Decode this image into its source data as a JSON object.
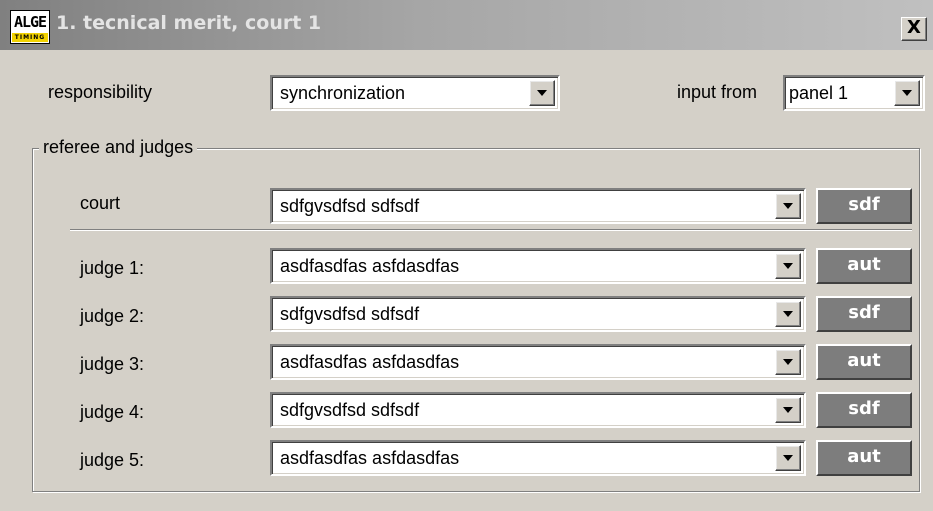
{
  "window": {
    "title": "1. tecnical merit, court 1",
    "logo_text": "ALGE",
    "logo_subtext": "TIMING",
    "close_label": "X"
  },
  "responsibility": {
    "label": "responsibility",
    "value": "synchronization"
  },
  "input_from": {
    "label": "input from",
    "value": "panel 1"
  },
  "group": {
    "title": "referee and judges"
  },
  "court": {
    "label": "court",
    "value": "sdfgvsdfsd sdfsdf",
    "tag": "sdf"
  },
  "judges": [
    {
      "label": "judge 1:",
      "value": "asdfasdfas asfdasdfas",
      "tag": "aut"
    },
    {
      "label": "judge 2:",
      "value": "sdfgvsdfsd sdfsdf",
      "tag": "sdf"
    },
    {
      "label": "judge 3:",
      "value": "asdfasdfas asfdasdfas",
      "tag": "aut"
    },
    {
      "label": "judge 4:",
      "value": "sdfgvsdfsd sdfsdf",
      "tag": "sdf"
    },
    {
      "label": "judge 5:",
      "value": "asdfasdfas asfdasdfas",
      "tag": "aut"
    }
  ]
}
